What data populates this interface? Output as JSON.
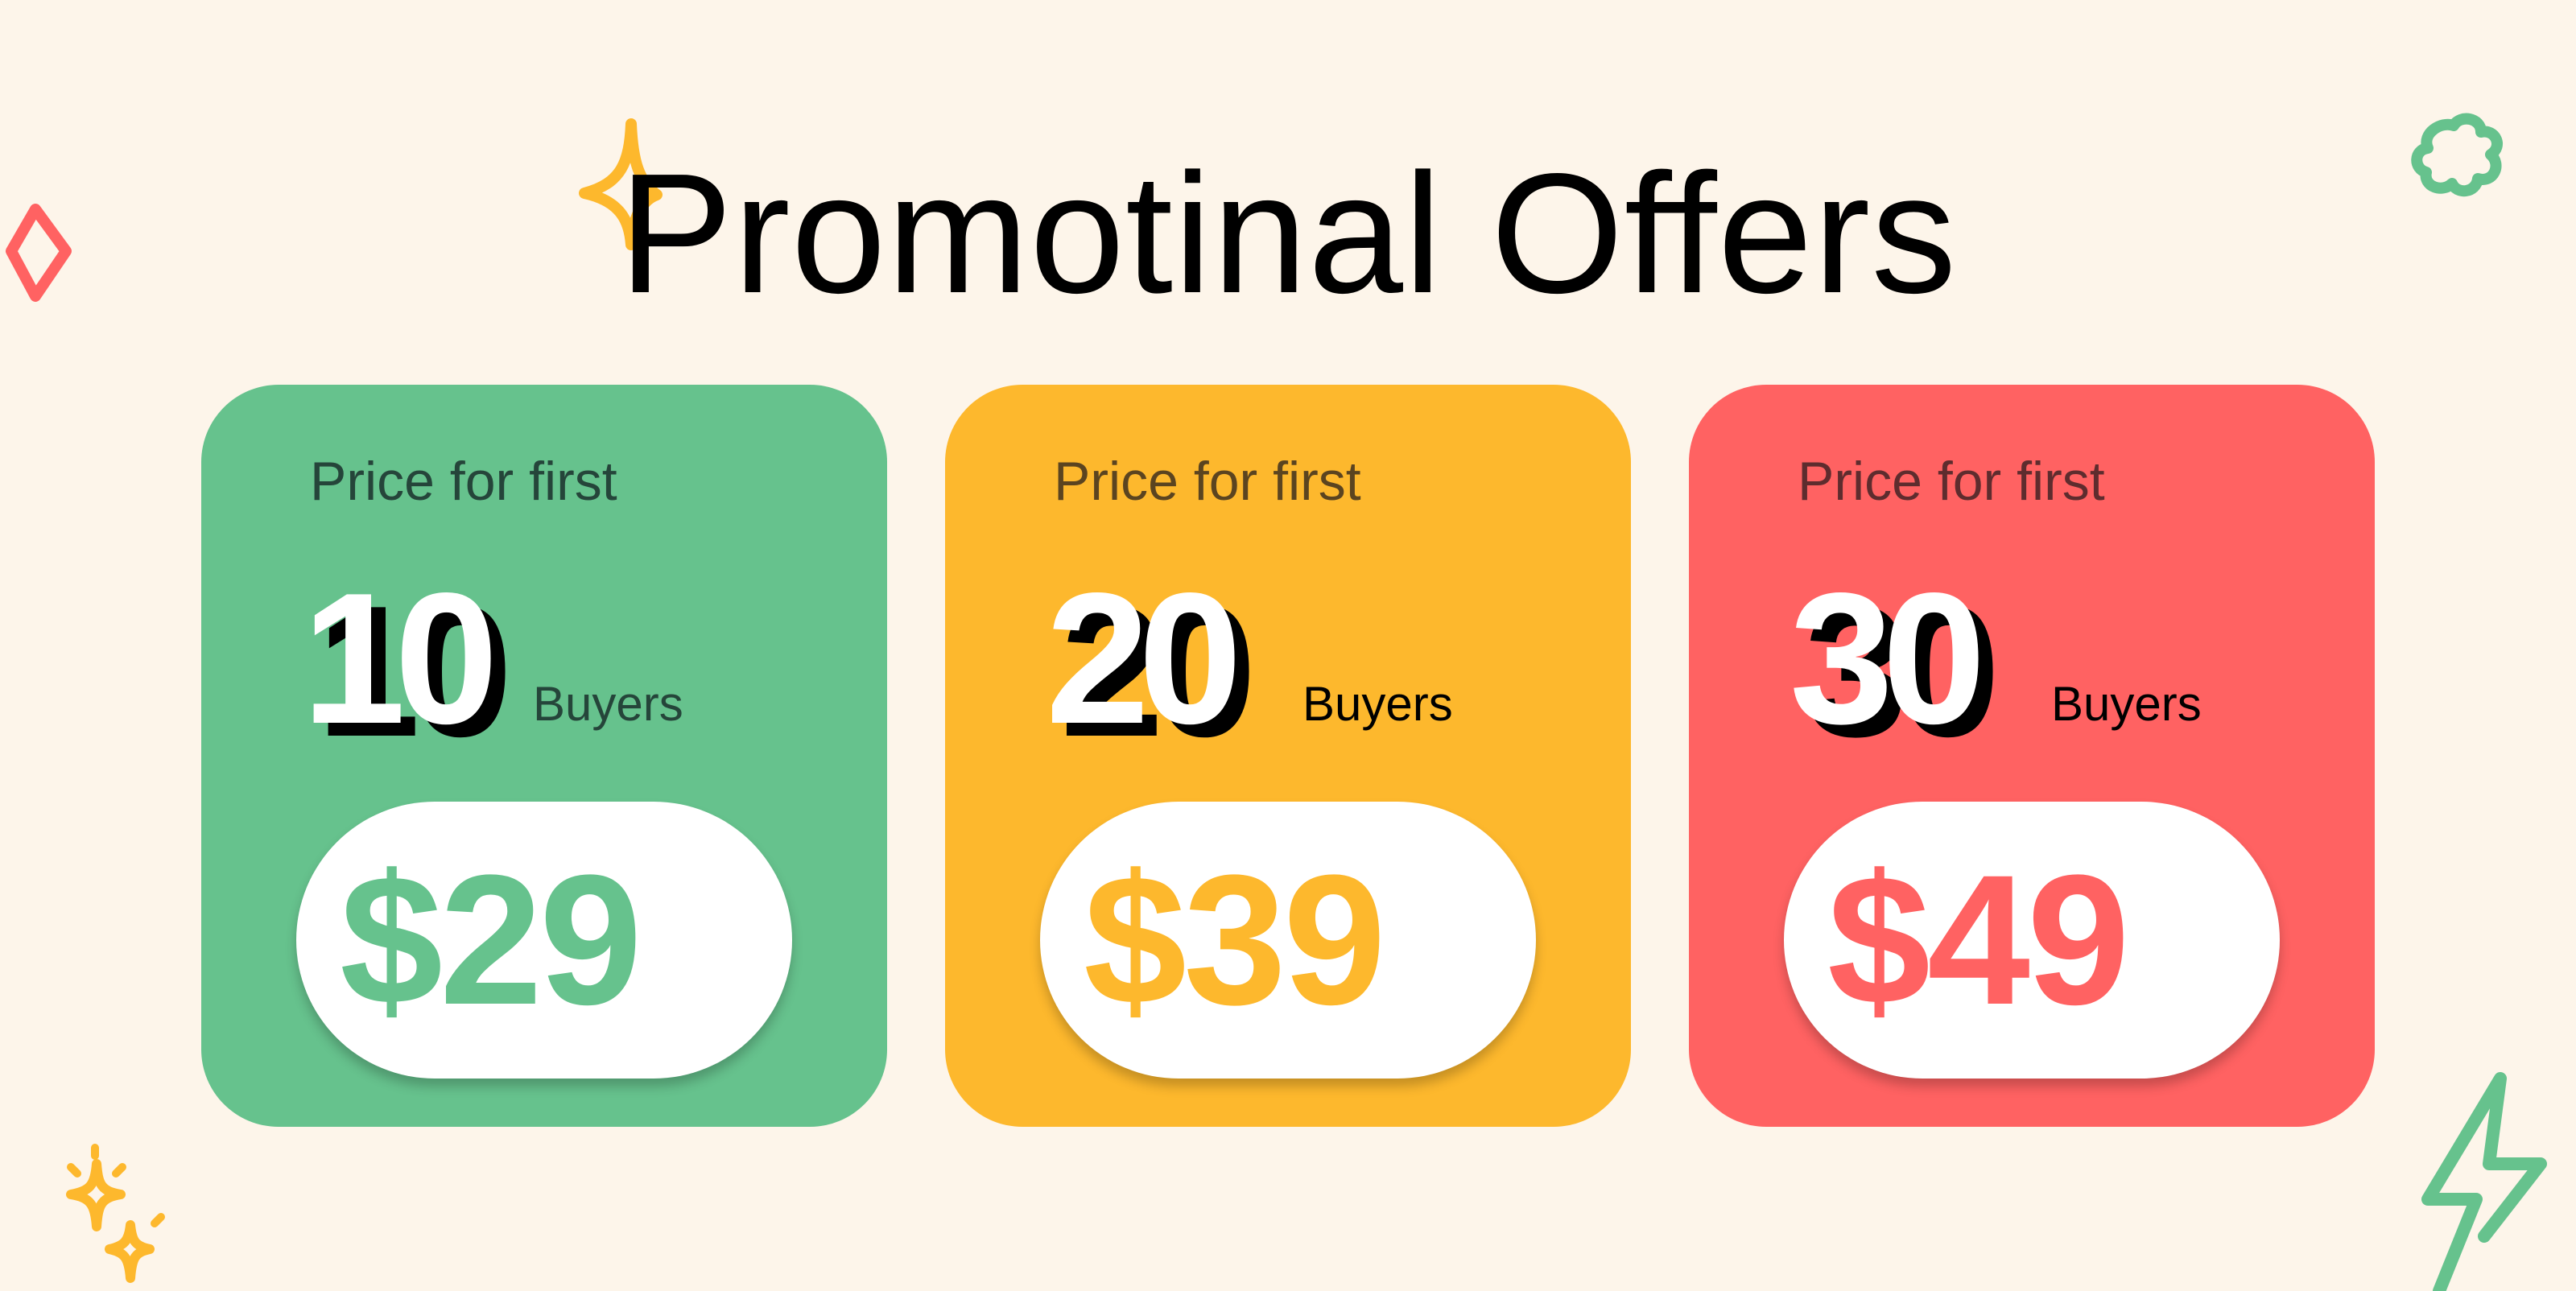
{
  "title": "Promotinal Offers",
  "colors": {
    "background": "#fdf5ea",
    "green": "#66c28d",
    "yellow": "#fdb82d",
    "red": "#ff6262",
    "count_text": "#ffffff",
    "count_shadow": "#000000",
    "pill": "#ffffff"
  },
  "decorations": [
    "sparkle-icon",
    "diamond-icon",
    "flower-icon",
    "sparkles-icon",
    "lightning-icon"
  ],
  "offers": [
    {
      "caption": "Price for first",
      "count": "10",
      "unit": "Buyers",
      "price": "$29",
      "color": "#66c28d",
      "caption_color": "#25453a"
    },
    {
      "caption": "Price for first",
      "count": "20",
      "unit": "Buyers",
      "price": "$39",
      "color": "#fdb82d",
      "caption_color": "#5b4420"
    },
    {
      "caption": "Price for first",
      "count": "30",
      "unit": "Buyers",
      "price": "$49",
      "color": "#ff6262",
      "caption_color": "#5e2c2e"
    }
  ]
}
